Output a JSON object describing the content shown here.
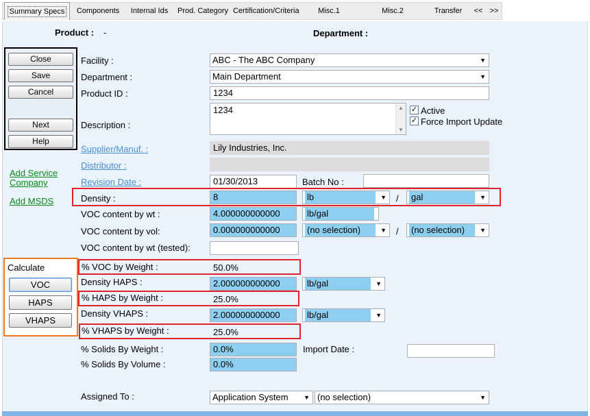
{
  "tabs": [
    "Summary Specs",
    "Components",
    "Internal Ids",
    "Prod. Category",
    "Certification/Criteria",
    "Misc.1",
    "Misc.2",
    "Transfer",
    "<<",
    ">>"
  ],
  "header": {
    "product_label": "Product :",
    "product_value": "-",
    "department_label": "Department :"
  },
  "actions": {
    "close": "Close",
    "save": "Save",
    "cancel": "Cancel",
    "next": "Next",
    "help": "Help"
  },
  "links": {
    "add_service_company": "Add Service Company",
    "add_msds": "Add MSDS"
  },
  "calculate": {
    "title": "Calculate",
    "voc": "VOC",
    "haps": "HAPS",
    "vhaps": "VHAPS"
  },
  "form": {
    "facility_label": "Facility :",
    "facility_value": "ABC - The ABC Company",
    "department_label": "Department :",
    "department_value": "Main Department",
    "product_id_label": "Product ID :",
    "product_id_value": "1234",
    "description_label": "Description :",
    "description_value": "1234",
    "active_label": "Active",
    "force_import_label": "Force Import Update",
    "supplier_label": "Supplier/Manuf. :",
    "supplier_value": "Lily Industries, Inc.",
    "distributor_label": "Distributor :",
    "distributor_value": "",
    "revision_date_label": "Revision Date :",
    "revision_date_value": "01/30/2013",
    "batch_no_label": "Batch No :",
    "batch_no_value": "",
    "density_label": "Density :",
    "density_value": "8",
    "density_unit1": "lb",
    "density_unit2": "gal",
    "voc_wt_label": "VOC content by wt :",
    "voc_wt_value": "4.000000000000",
    "voc_wt_unit": "lb/gal",
    "voc_vol_label": "VOC content by vol:",
    "voc_vol_value": "0.000000000000",
    "voc_vol_unit1": "(no selection)",
    "voc_vol_unit2": "(no selection)",
    "voc_tested_label": "VOC content by wt (tested):",
    "voc_tested_value": "",
    "pct_voc_label": "% VOC by Weight :",
    "pct_voc_value": "50.0%",
    "density_haps_label": "Density HAPS :",
    "density_haps_value": "2.000000000000",
    "density_haps_unit": "lb/gal",
    "pct_haps_label": "% HAPS by Weight :",
    "pct_haps_value": "25.0%",
    "density_vhaps_label": "Density VHAPS :",
    "density_vhaps_value": "2.000000000000",
    "density_vhaps_unit": "lb/gal",
    "pct_vhaps_label": "% VHAPS by Weight :",
    "pct_vhaps_value": "25.0%",
    "solids_wt_label": "% Solids By Weight :",
    "solids_wt_value": "0.0%",
    "import_date_label": "Import Date :",
    "import_date_value": "",
    "solids_vol_label": "% Solids By Volume :",
    "solids_vol_value": "0.0%",
    "assigned_to_label": "Assigned To :",
    "assigned_to_value1": "Application System",
    "assigned_to_value2": "(no selection)",
    "slash": "/"
  },
  "colors": {
    "highlight_box": "#e0202a",
    "calc_box": "#f07a1a",
    "field_blue": "#8ccff0",
    "link_green": "#0a8a1a",
    "link_blue": "#4a8fd6"
  }
}
